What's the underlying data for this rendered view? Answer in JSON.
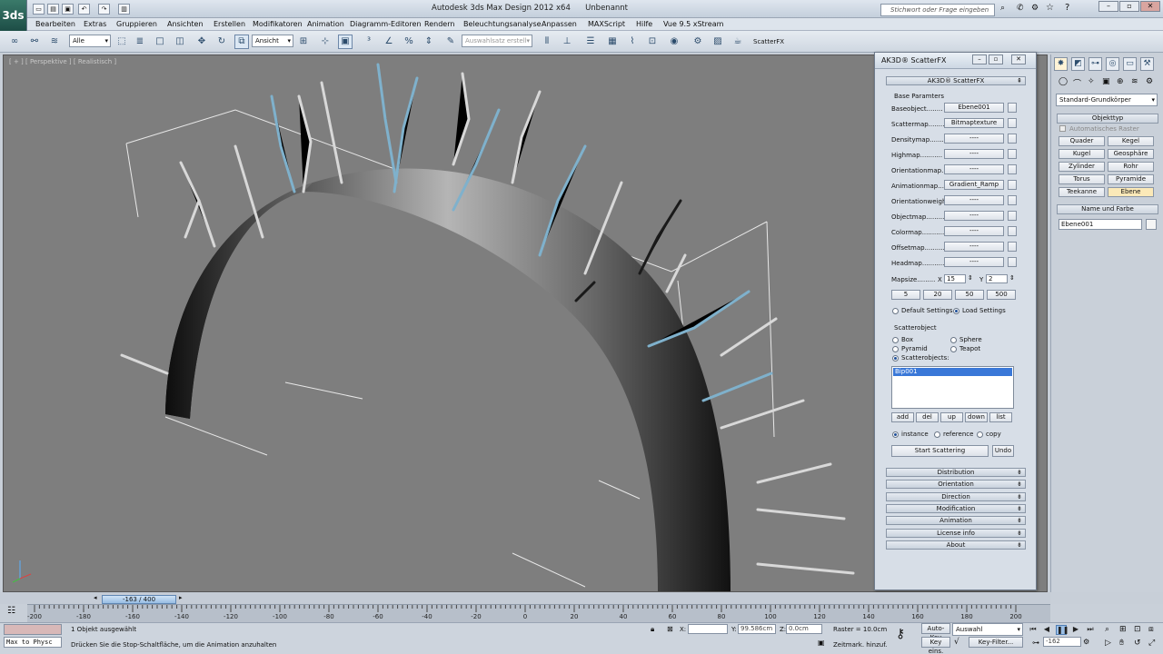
{
  "app": {
    "logo": "3ds",
    "title": "Autodesk 3ds Max Design 2012 x64",
    "document": "Unbenannt",
    "search_placeholder": "Stichwort oder Frage eingeben"
  },
  "menu": [
    "Bearbeiten",
    "Extras",
    "Gruppieren",
    "Ansichten",
    "Erstellen",
    "Modifikatoren",
    "Animation",
    "Diagramm-Editoren",
    "Rendern",
    "Beleuchtungsanalyse",
    "Anpassen",
    "MAXScript",
    "Hilfe",
    "Vue 9.5 xStream"
  ],
  "toolbar": {
    "filter_select": "Alle",
    "coord_select": "Ansicht",
    "selection_set_placeholder": "Auswahlsatz erstell",
    "scatterfx_label": "ScatterFX"
  },
  "viewport": {
    "label": "[ + ] [ Perspektive ] [ Realistisch ]"
  },
  "command_panel": {
    "category_select": "Standard-Grundkörper",
    "object_type_header": "Objekttyp",
    "auto_grid": "Automatisches Raster",
    "primitives": [
      "Quader",
      "Kegel",
      "Kugel",
      "Geosphäre",
      "Zylinder",
      "Rohr",
      "Torus",
      "Pyramide",
      "Teekanne",
      "Ebene"
    ],
    "name_color_header": "Name und Farbe",
    "object_name": "Ebene001"
  },
  "scatterfx": {
    "window_title": "AK3D® ScatterFX",
    "rollout_title": "AK3D® ScatterFX",
    "base_params_label": "Base Paramters",
    "maps": [
      {
        "label": "Baseobject........",
        "value": "Ebene001"
      },
      {
        "label": "Scattermap........",
        "value": "Bitmaptexture"
      },
      {
        "label": "Densitymap.......",
        "value": "----"
      },
      {
        "label": "Highmap...........",
        "value": "----"
      },
      {
        "label": "Orientationmap...",
        "value": "----"
      },
      {
        "label": "Animationmap.....",
        "value": "Gradient_Ramp"
      },
      {
        "label": "Orientationweigh",
        "value": "----"
      },
      {
        "label": "Objectmap.........",
        "value": "----"
      },
      {
        "label": "Colormap...........",
        "value": "----"
      },
      {
        "label": "Offsetmap..........",
        "value": "----"
      },
      {
        "label": "Headmap............",
        "value": "----"
      }
    ],
    "mapsize_label": "Mapsize.........",
    "mapsize_x_label": "X",
    "mapsize_x": "15",
    "mapsize_y_label": "Y",
    "mapsize_y": "2",
    "presets": [
      "5",
      "20",
      "50",
      "500"
    ],
    "default_settings": "Default Settings",
    "load_settings": "Load Settings",
    "scatterobject_label": "Scatterobject",
    "shapes": {
      "box": "Box",
      "sphere": "Sphere",
      "pyramid": "Pyramid",
      "teapot": "Teapot"
    },
    "scatterobjects_label": "Scatterobjects:",
    "list_items": [
      "Bip001"
    ],
    "list_buttons": [
      "add",
      "del",
      "up",
      "down",
      "list"
    ],
    "mode_instance": "instance",
    "mode_reference": "reference",
    "mode_copy": "copy",
    "start_button": "Start Scattering",
    "undo_button": "Undo",
    "rollouts": [
      "Distribution",
      "Orientation",
      "Direction",
      "Modification",
      "Animation",
      "License info",
      "About"
    ]
  },
  "timeline": {
    "frame_display": "-163 / 400",
    "ticks": [
      "-200",
      "-180",
      "-160",
      "-140",
      "-120",
      "-100",
      "-80",
      "-60",
      "-40",
      "-20",
      "0",
      "20",
      "40",
      "60",
      "80",
      "100",
      "120",
      "140",
      "160",
      "180",
      "200"
    ]
  },
  "status": {
    "maxscript": "Max to Physc",
    "selected": "1 Objekt ausgewählt",
    "prompt": "Drücken Sie die Stop-Schaltfläche, um die Animation anzuhalten",
    "x_label": "X:",
    "x_value": "",
    "y_label": "Y:",
    "y_value": "99.586cm",
    "z_label": "Z:",
    "z_value": "0.0cm",
    "grid": "Raster = 10.0cm",
    "add_time_tag": "Zeitmark. hinzuf.",
    "auto_key": "Auto-Key",
    "set_key": "Key eins.",
    "selection_select": "Auswahl",
    "key_filters": "Key-Filter...",
    "current_frame": "-162"
  }
}
